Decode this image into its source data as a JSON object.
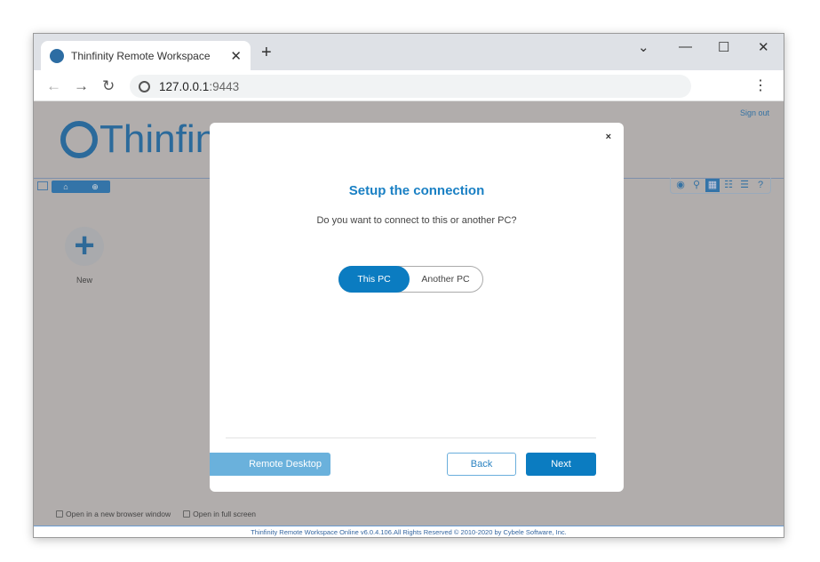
{
  "browser": {
    "tab_title": "Thinfinity Remote Workspace",
    "url_host": "127.0.0.1",
    "url_port": ":9443"
  },
  "app": {
    "logo_text": "Thinfinity",
    "sign_out": "Sign out",
    "new_label": "New",
    "options": [
      "Open in a new browser window",
      "Open in full screen"
    ],
    "footer": "Thinfinity Remote Workspace Online v6.0.4.106.All Rights Reserved © 2010-2020 by Cybele Software, Inc.",
    "brand_color": "#2b6a9b"
  },
  "modal": {
    "close": "×",
    "title": "Setup the connection",
    "question": "Do you want to connect to this or another PC?",
    "options": [
      {
        "label": "This PC",
        "selected": true
      },
      {
        "label": "Another PC",
        "selected": false
      }
    ],
    "protocol_label": "Remote Desktop",
    "back_label": "Back",
    "next_label": "Next",
    "accent": "#0b7cc1"
  }
}
